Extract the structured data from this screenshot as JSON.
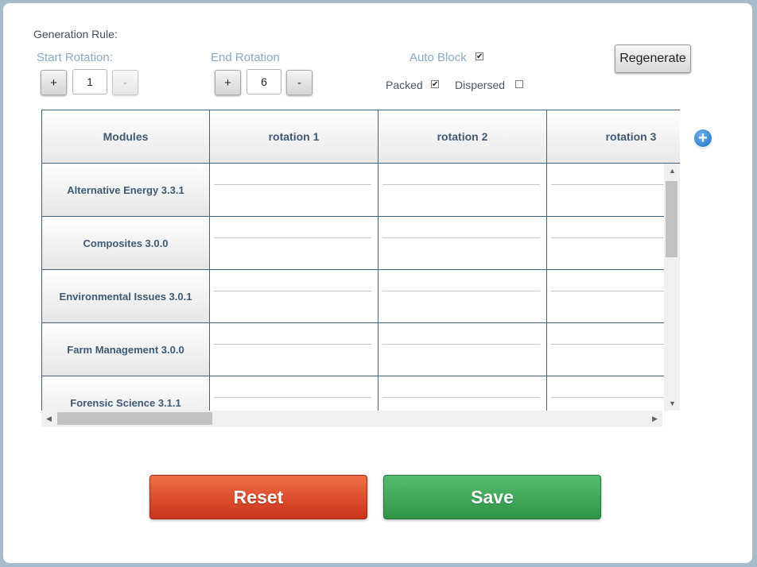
{
  "generation": {
    "title": "Generation Rule:",
    "start_rotation": {
      "label": "Start Rotation:",
      "plus": "+",
      "minus": "-",
      "value": "1"
    },
    "end_rotation": {
      "label": "End Rotation",
      "plus": "+",
      "minus": "-",
      "value": "6"
    },
    "auto_block": {
      "label": "Auto Block",
      "checked": true
    },
    "packed": {
      "label": "Packed",
      "checked": true
    },
    "dispersed": {
      "label": "Dispersed",
      "checked": false
    },
    "regenerate_label": "Regenerate"
  },
  "grid": {
    "columns": [
      "Modules",
      "rotation 1",
      "rotation 2",
      "rotation 3"
    ],
    "rows": [
      "Alternative Energy 3.3.1",
      "Composites 3.0.0",
      "Environmental Issues 3.0.1",
      "Farm Management 3.0.0",
      "Forensic Science 3.1.1"
    ]
  },
  "add_column_icon": "plus-circle-icon",
  "actions": {
    "reset_label": "Reset",
    "save_label": "Save"
  },
  "colors": {
    "reset": "#d9441f",
    "save": "#3faa5a",
    "grid_border": "#3f6381",
    "header_text": "#3d5a74",
    "label_blue": "#8aaac3"
  }
}
